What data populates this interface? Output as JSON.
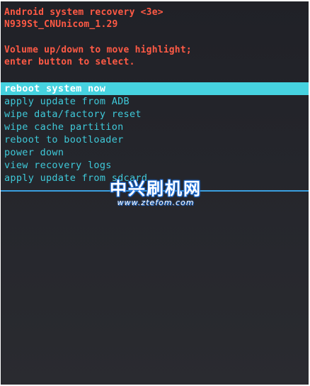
{
  "header": {
    "title": "Android system recovery <3e>",
    "build": "N939St_CNUnicom_1.29",
    "instruction_1": "Volume up/down to move highlight;",
    "instruction_2": "enter button to select."
  },
  "menu": {
    "items": [
      {
        "label": "reboot system now",
        "selected": true
      },
      {
        "label": "apply update from ADB",
        "selected": false
      },
      {
        "label": "wipe data/factory reset",
        "selected": false
      },
      {
        "label": "wipe cache partition",
        "selected": false
      },
      {
        "label": "reboot to bootloader",
        "selected": false
      },
      {
        "label": "power down",
        "selected": false
      },
      {
        "label": "view recovery logs",
        "selected": false
      },
      {
        "label": "apply update from sdcard",
        "selected": false
      }
    ]
  },
  "watermark": {
    "logo_text": "中兴刷机网",
    "url": "www.ztefom.com"
  },
  "colors": {
    "header_text": "#ff5a45",
    "menu_text": "#3fc9d9",
    "highlight": "#46d3e0",
    "background": "#222329"
  }
}
